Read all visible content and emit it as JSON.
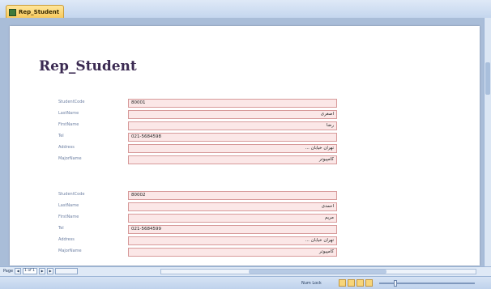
{
  "window": {
    "tab_label": "Rep_Student"
  },
  "report": {
    "title": "Rep_Student",
    "records": [
      {
        "fields": [
          {
            "label": "StudentCode",
            "value": "80001"
          },
          {
            "label": "LastName",
            "value": "اصغری"
          },
          {
            "label": "FirstName",
            "value": "رضا"
          },
          {
            "label": "Tel",
            "value": "021-5684598"
          },
          {
            "label": "Address",
            "value": "تهران خیابان ..."
          },
          {
            "label": "MajorName",
            "value": "کامپیوتر"
          }
        ]
      },
      {
        "fields": [
          {
            "label": "StudentCode",
            "value": "80002"
          },
          {
            "label": "LastName",
            "value": "احمدی"
          },
          {
            "label": "FirstName",
            "value": "مریم"
          },
          {
            "label": "Tel",
            "value": "021-5684599"
          },
          {
            "label": "Address",
            "value": "تهران خیابان ..."
          },
          {
            "label": "MajorName",
            "value": "کامپیوتر"
          }
        ]
      }
    ]
  },
  "navigation": {
    "record_label": "Page",
    "current": "1 of 1",
    "filter_label": "No Filter"
  },
  "status": {
    "text": "Num Lock"
  },
  "colors": {
    "label": "#6c7fa2",
    "field_border": "#d79a9a",
    "field_fill": "#fbe7e7",
    "title": "#3b2a52"
  }
}
